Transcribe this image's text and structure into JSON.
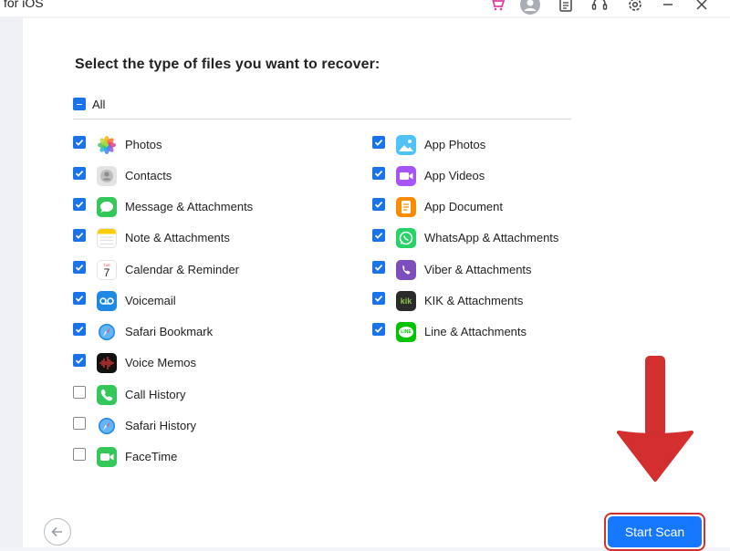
{
  "window": {
    "title": "for iOS",
    "icons": [
      "cart-icon",
      "user-icon",
      "document-icon",
      "support-icon",
      "settings-icon",
      "minimize-icon",
      "close-icon"
    ]
  },
  "main": {
    "heading": "Select the type of files you want to recover:",
    "select_all": {
      "label": "All",
      "state": "partial"
    },
    "left_column": [
      {
        "label": "Photos",
        "checked": true,
        "icon": "photos-icon"
      },
      {
        "label": "Contacts",
        "checked": true,
        "icon": "contacts-icon"
      },
      {
        "label": "Message & Attachments",
        "checked": true,
        "icon": "messages-icon"
      },
      {
        "label": "Note & Attachments",
        "checked": true,
        "icon": "notes-icon"
      },
      {
        "label": "Calendar & Reminder",
        "checked": true,
        "icon": "calendar-icon",
        "icon_text": "7",
        "icon_day": "TUE"
      },
      {
        "label": "Voicemail",
        "checked": true,
        "icon": "voicemail-icon"
      },
      {
        "label": "Safari Bookmark",
        "checked": true,
        "icon": "safari-icon"
      },
      {
        "label": "Voice Memos",
        "checked": true,
        "icon": "voice-memos-icon"
      },
      {
        "label": "Call History",
        "checked": false,
        "icon": "phone-icon"
      },
      {
        "label": "Safari History",
        "checked": false,
        "icon": "safari-icon"
      },
      {
        "label": "FaceTime",
        "checked": false,
        "icon": "facetime-icon"
      }
    ],
    "right_column": [
      {
        "label": "App Photos",
        "checked": true,
        "icon": "app-photos-icon"
      },
      {
        "label": "App Videos",
        "checked": true,
        "icon": "app-videos-icon"
      },
      {
        "label": "App Document",
        "checked": true,
        "icon": "app-document-icon"
      },
      {
        "label": "WhatsApp & Attachments",
        "checked": true,
        "icon": "whatsapp-icon"
      },
      {
        "label": "Viber & Attachments",
        "checked": true,
        "icon": "viber-icon"
      },
      {
        "label": "KIK & Attachments",
        "checked": true,
        "icon": "kik-icon",
        "icon_text": "kik"
      },
      {
        "label": "Line & Attachments",
        "checked": true,
        "icon": "line-icon",
        "icon_text": "LINE"
      }
    ]
  },
  "footer": {
    "back_icon": "back-arrow-icon",
    "start_scan_label": "Start Scan"
  },
  "colors": {
    "accent": "#1677ff",
    "checkbox": "#1a73e8",
    "highlight": "#d32f2f"
  }
}
